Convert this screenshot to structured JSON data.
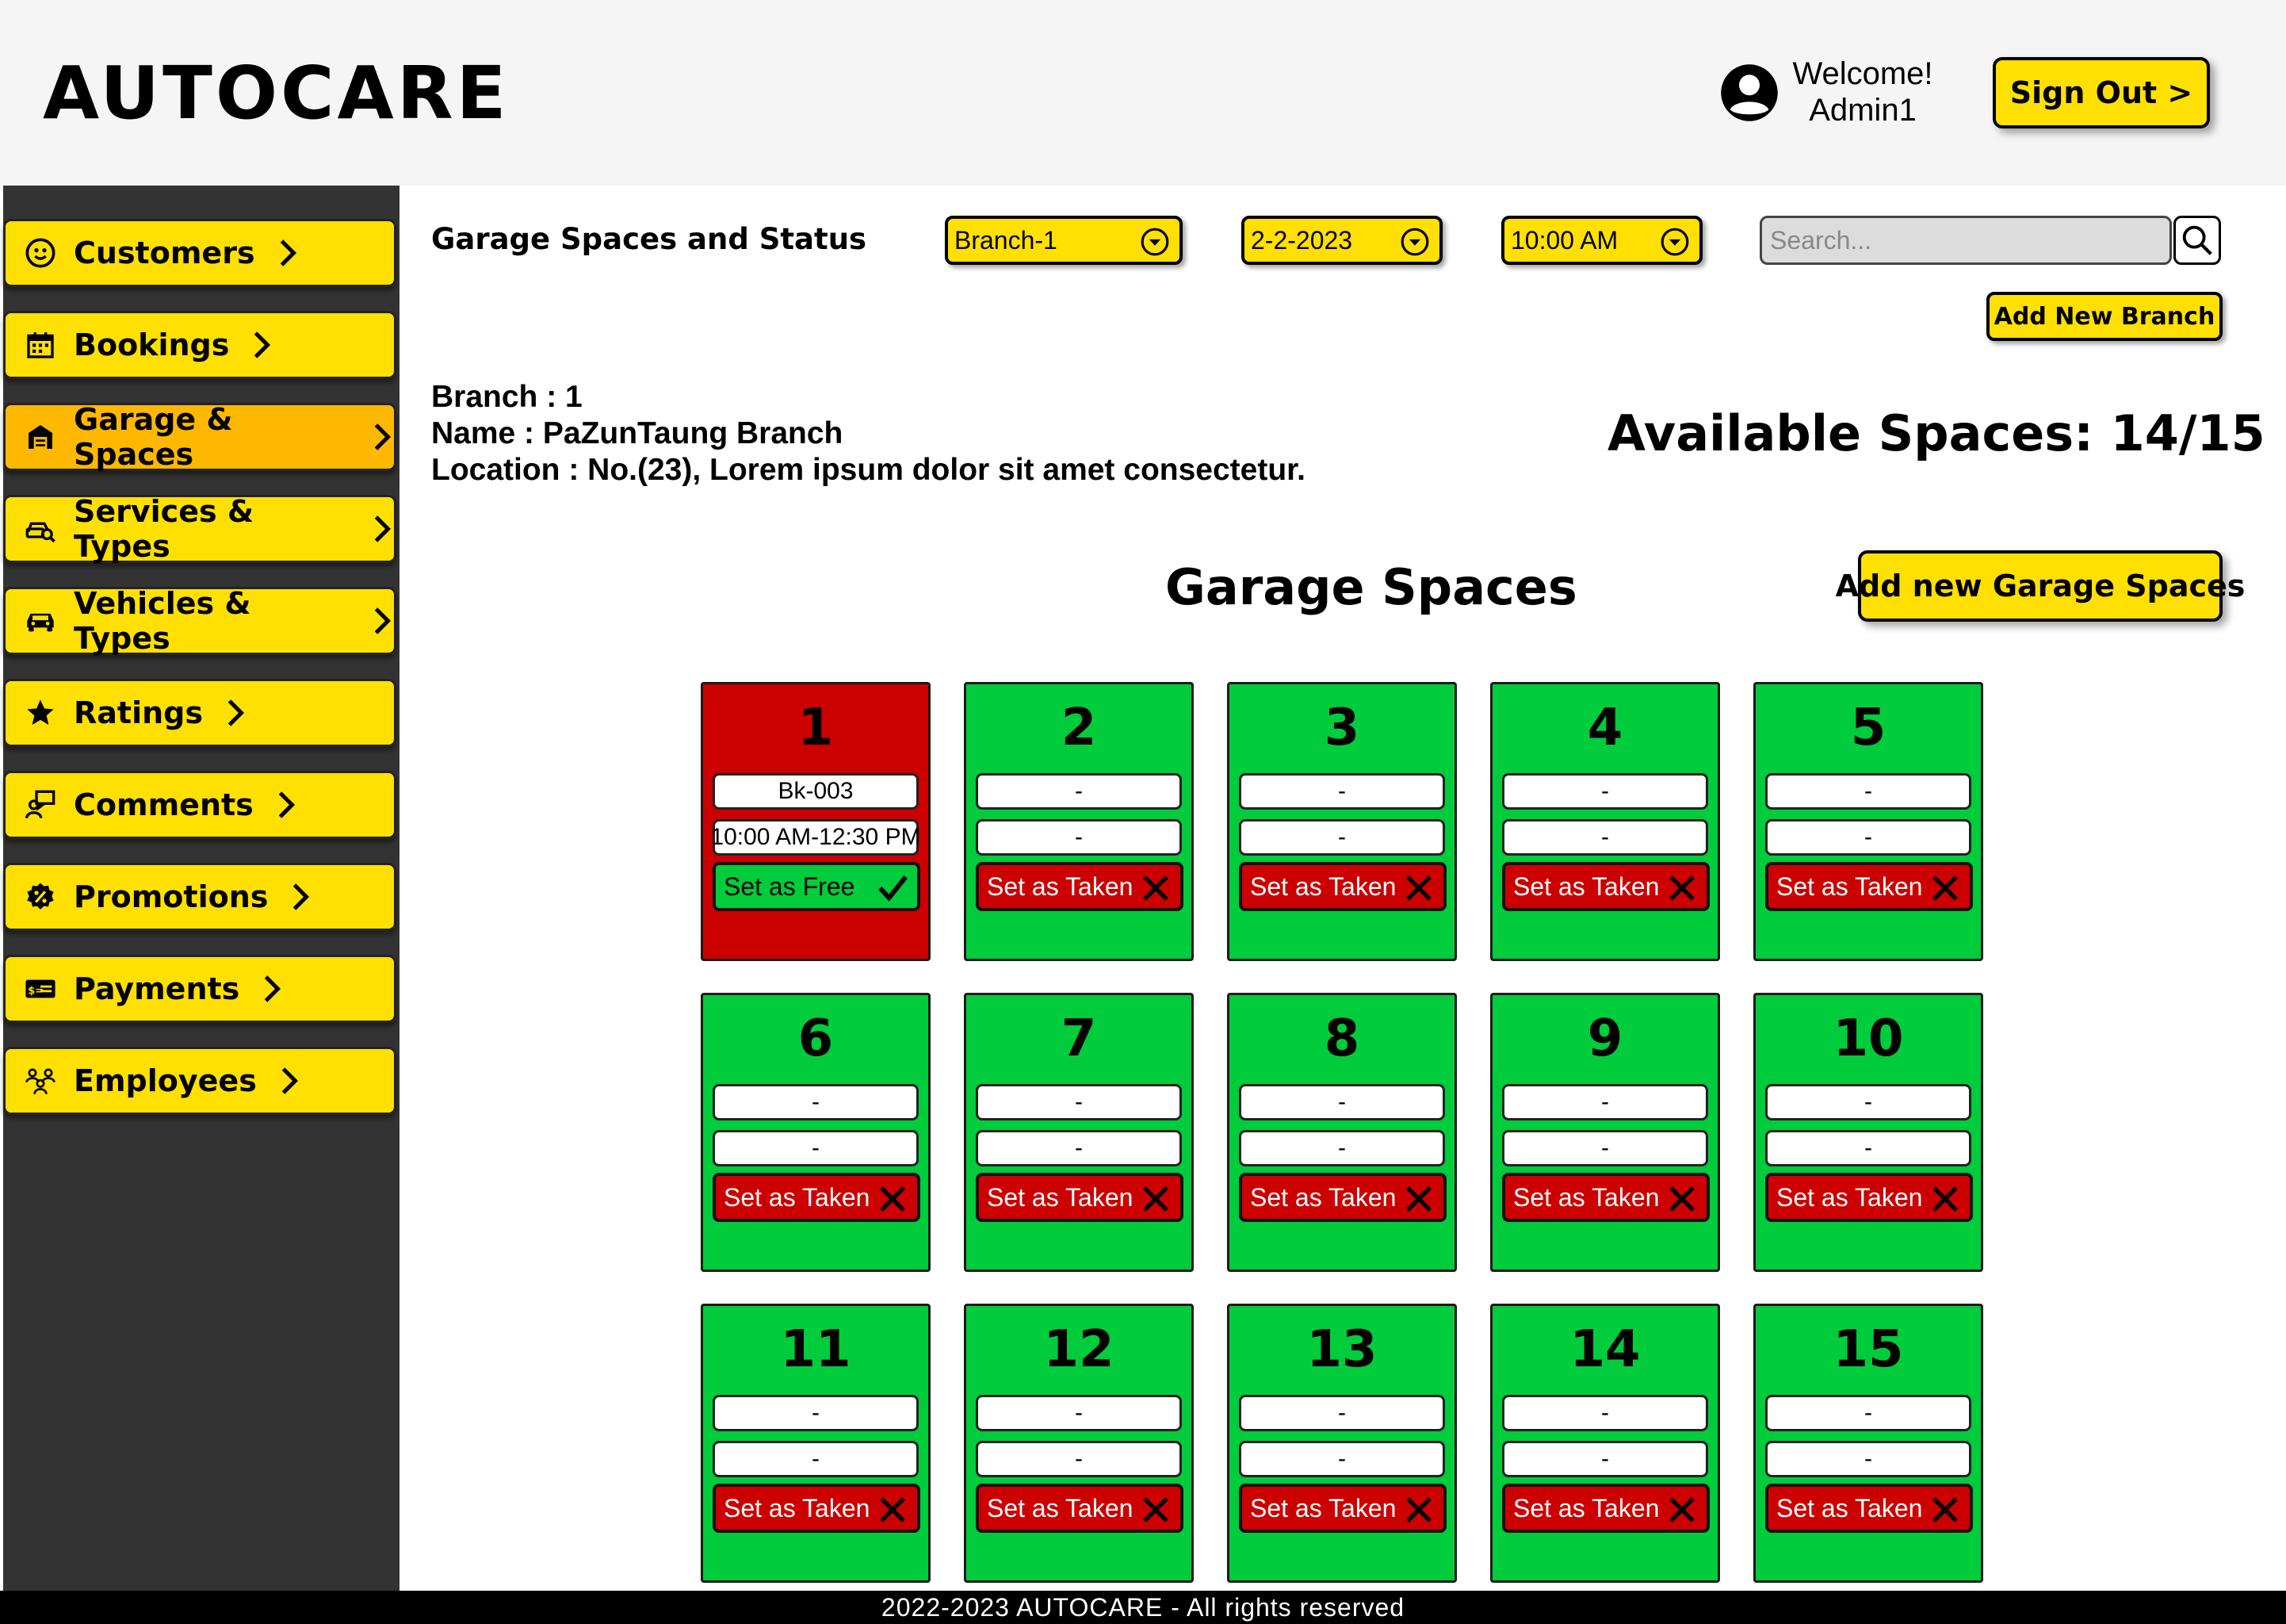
{
  "header": {
    "brand": "AUTOCARE",
    "welcome_line1": "Welcome!",
    "welcome_line2": "Admin1",
    "signout_label": "Sign Out >"
  },
  "sidebar": {
    "items": [
      {
        "label": "Customers",
        "icon": "customer-face-icon"
      },
      {
        "label": "Bookings",
        "icon": "calendar-icon"
      },
      {
        "label": "Garage & Spaces",
        "icon": "garage-icon",
        "active": true
      },
      {
        "label": "Services & Types",
        "icon": "car-service-icon"
      },
      {
        "label": "Vehicles & Types",
        "icon": "car-icon"
      },
      {
        "label": "Ratings",
        "icon": "star-icon"
      },
      {
        "label": "Comments",
        "icon": "comment-person-icon"
      },
      {
        "label": "Promotions",
        "icon": "promotion-badge-icon"
      },
      {
        "label": "Payments",
        "icon": "payment-card-icon"
      },
      {
        "label": "Employees",
        "icon": "employees-icon"
      }
    ]
  },
  "toolbar": {
    "title": "Garage Spaces and Status",
    "branch_select": "Branch-1",
    "date_select": "2-2-2023",
    "time_select": "10:00 AM",
    "search_placeholder": "Search...",
    "add_branch_label": "Add New Branch"
  },
  "branch": {
    "id_line": "Branch : 1",
    "name_line": "Name : PaZunTaung Branch",
    "location_line": "Location :  No.(23), Lorem ipsum dolor sit amet consectetur."
  },
  "available_spaces": "Available Spaces: 14/15",
  "garage": {
    "section_title": "Garage Spaces",
    "add_space_label": "Add new Garage Spaces",
    "spaces": [
      {
        "number": "1",
        "booking": "Bk-003",
        "time": "10:00 AM-12:30 PM",
        "status": "taken",
        "action": "Set as Free"
      },
      {
        "number": "2",
        "booking": "-",
        "time": "-",
        "status": "free",
        "action": "Set as Taken"
      },
      {
        "number": "3",
        "booking": "-",
        "time": "-",
        "status": "free",
        "action": "Set as Taken"
      },
      {
        "number": "4",
        "booking": "-",
        "time": "-",
        "status": "free",
        "action": "Set as Taken"
      },
      {
        "number": "5",
        "booking": "-",
        "time": "-",
        "status": "free",
        "action": "Set as Taken"
      },
      {
        "number": "6",
        "booking": "-",
        "time": "-",
        "status": "free",
        "action": "Set as Taken"
      },
      {
        "number": "7",
        "booking": "-",
        "time": "-",
        "status": "free",
        "action": "Set as Taken"
      },
      {
        "number": "8",
        "booking": "-",
        "time": "-",
        "status": "free",
        "action": "Set as Taken"
      },
      {
        "number": "9",
        "booking": "-",
        "time": "-",
        "status": "free",
        "action": "Set as Taken"
      },
      {
        "number": "10",
        "booking": "-",
        "time": "-",
        "status": "free",
        "action": "Set as Taken"
      },
      {
        "number": "11",
        "booking": "-",
        "time": "-",
        "status": "free",
        "action": "Set as Taken"
      },
      {
        "number": "12",
        "booking": "-",
        "time": "-",
        "status": "free",
        "action": "Set as Taken"
      },
      {
        "number": "13",
        "booking": "-",
        "time": "-",
        "status": "free",
        "action": "Set as Taken"
      },
      {
        "number": "14",
        "booking": "-",
        "time": "-",
        "status": "free",
        "action": "Set as Taken"
      },
      {
        "number": "15",
        "booking": "-",
        "time": "-",
        "status": "free",
        "action": "Set as Taken"
      }
    ]
  },
  "footer": {
    "text": "2022-2023 AUTOCARE - All rights reserved"
  },
  "colors": {
    "accent": "#ffe000",
    "active_nav": "#ffb800",
    "free": "#00cc3c",
    "taken": "#cc0000",
    "sidebar": "#333333"
  }
}
